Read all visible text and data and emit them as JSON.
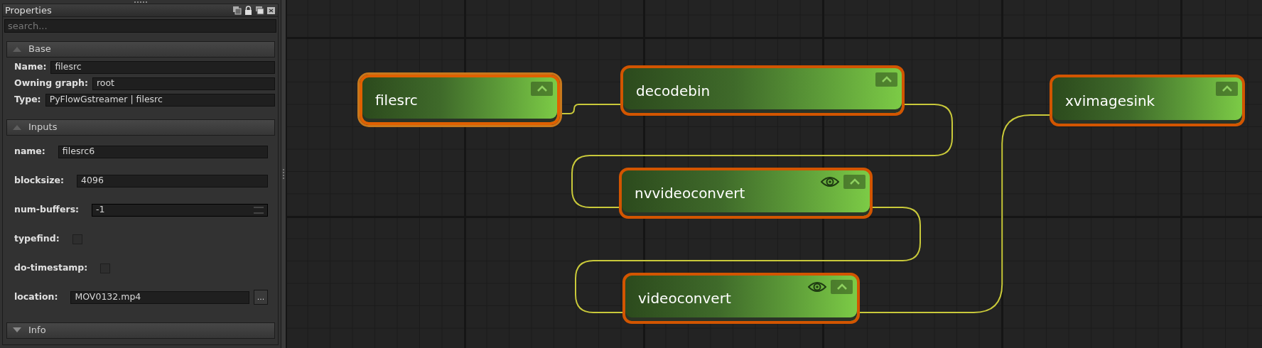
{
  "panel": {
    "title": "Properties",
    "search": {
      "placeholder": "search..."
    },
    "sections": [
      {
        "title": "Base",
        "expanded": true,
        "kind": "base",
        "rows": [
          {
            "kind": "text",
            "label": "Name:",
            "value": "filesrc"
          },
          {
            "kind": "text",
            "label": "Owning graph:",
            "value": "root"
          },
          {
            "kind": "text",
            "label": "Type:",
            "value": "PyFlowGstreamer | filesrc"
          }
        ]
      },
      {
        "title": "Inputs",
        "expanded": true,
        "kind": "inputs",
        "rows": [
          {
            "kind": "text",
            "label": "name:",
            "value": "filesrc6"
          },
          {
            "kind": "text",
            "label": "blocksize:",
            "value": "4096"
          },
          {
            "kind": "spin",
            "label": "num-buffers:",
            "value": "-1"
          },
          {
            "kind": "check",
            "label": "typefind:",
            "checked": false
          },
          {
            "kind": "check",
            "label": "do-timestamp:",
            "checked": false
          },
          {
            "kind": "file",
            "label": "location:",
            "value": "MOV0132.mp4",
            "button": "..."
          }
        ]
      },
      {
        "title": "Info",
        "expanded": false,
        "kind": "info"
      }
    ]
  },
  "nodes": [
    {
      "title": "filesrc",
      "selected": true,
      "preview": false
    },
    {
      "title": "decodebin",
      "selected": false,
      "preview": false
    },
    {
      "title": "nvvideoconvert",
      "selected": false,
      "preview": true
    },
    {
      "title": "videoconvert",
      "selected": false,
      "preview": true
    },
    {
      "title": "xvimagesink",
      "selected": false,
      "preview": false
    }
  ]
}
